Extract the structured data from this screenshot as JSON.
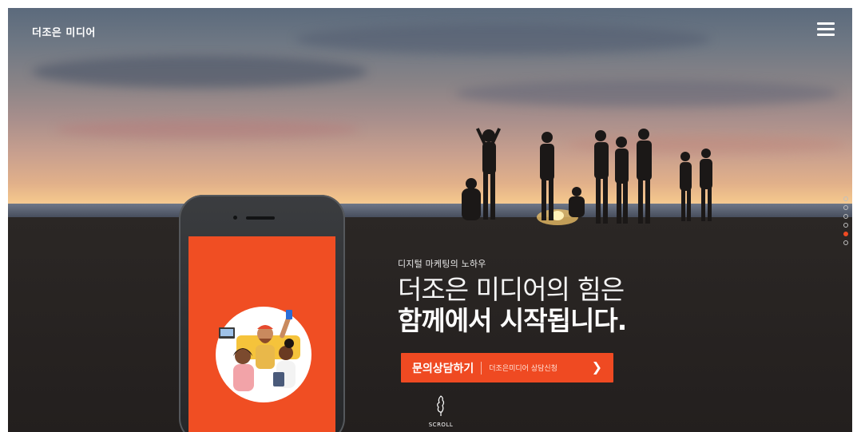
{
  "header": {
    "logo_text": "더조은 미디어",
    "menu_icon": "hamburger-icon"
  },
  "hero": {
    "eyebrow": "디지털 마케팅의 노하우",
    "line1": "더조은 미디어의 힘은",
    "line2": "함께에서 시작됩니다."
  },
  "cta": {
    "main_label": "문의상담하기",
    "sub_label": "더조은미디어 상담신청",
    "arrow": "❯"
  },
  "scroll": {
    "label": "SCROLL",
    "icon": "scroll-hand-icon"
  },
  "pagination": {
    "count": 6,
    "active_index": 4
  },
  "colors": {
    "accent": "#ef4a22",
    "phone_screen": "#f04e23",
    "text": "#ffffff"
  }
}
